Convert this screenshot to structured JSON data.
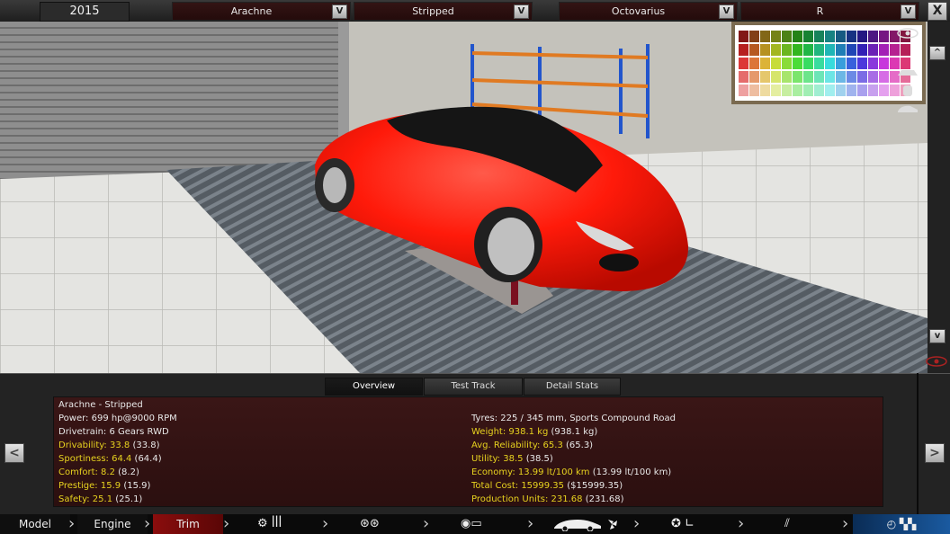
{
  "topbar": {
    "year": "2015",
    "model": "Arachne",
    "trim": "Stripped",
    "engine": "Octovarius",
    "variant": "R",
    "dropdown_arrow": "V",
    "close_label": "X"
  },
  "camera": {
    "up_label": "^",
    "down_label": "v"
  },
  "tabs": {
    "overview": "Overview",
    "test_track": "Test Track",
    "detail_stats": "Detail Stats",
    "active": "overview"
  },
  "stats": {
    "title": "Arachne - Stripped",
    "power": "Power: 699 hp@9000 RPM",
    "drivetrain": "Drivetrain: 6 Gears RWD",
    "drivability_label": "Drivability: 33.8",
    "drivability_paren": "(33.8)",
    "sportiness_label": "Sportiness: 64.4",
    "sportiness_paren": "(64.4)",
    "comfort_label": "Comfort: 8.2",
    "comfort_paren": "(8.2)",
    "prestige_label": "Prestige: 15.9",
    "prestige_paren": "(15.9)",
    "safety_label": "Safety: 25.1",
    "safety_paren": "(25.1)",
    "tyres": "Tyres: 225 / 345 mm, Sports Compound Road",
    "weight_label": "Weight: 938.1 kg",
    "weight_paren": "(938.1 kg)",
    "reliability_label": "Avg. Reliability: 65.3",
    "reliability_paren": "(65.3)",
    "utility_label": "Utility: 38.5",
    "utility_paren": "(38.5)",
    "economy_label": "Economy: 13.99 lt/100 km",
    "economy_paren": "(13.99 lt/100 km)",
    "cost_label": "Total Cost: 15999.35",
    "cost_paren": "($15999.35)",
    "units_label": "Production Units: 231.68",
    "units_paren": "(231.68)"
  },
  "nav": {
    "prev": "<",
    "next": ">"
  },
  "bottom_nav": {
    "model": "Model",
    "engine": "Engine",
    "trim": "Trim",
    "active": "Trim",
    "icons": [
      "gearbox-icon",
      "wheels-icon",
      "chassis-icon",
      "body-aero-icon",
      "interior-icon",
      "suspension-icon",
      "finish-icon"
    ]
  },
  "colors": {
    "car_body": "#ff1a0a",
    "highlight_yellow": "#e7d21f",
    "stat_box": "#3a1616",
    "active_tab_red": "#8a0d0d"
  }
}
